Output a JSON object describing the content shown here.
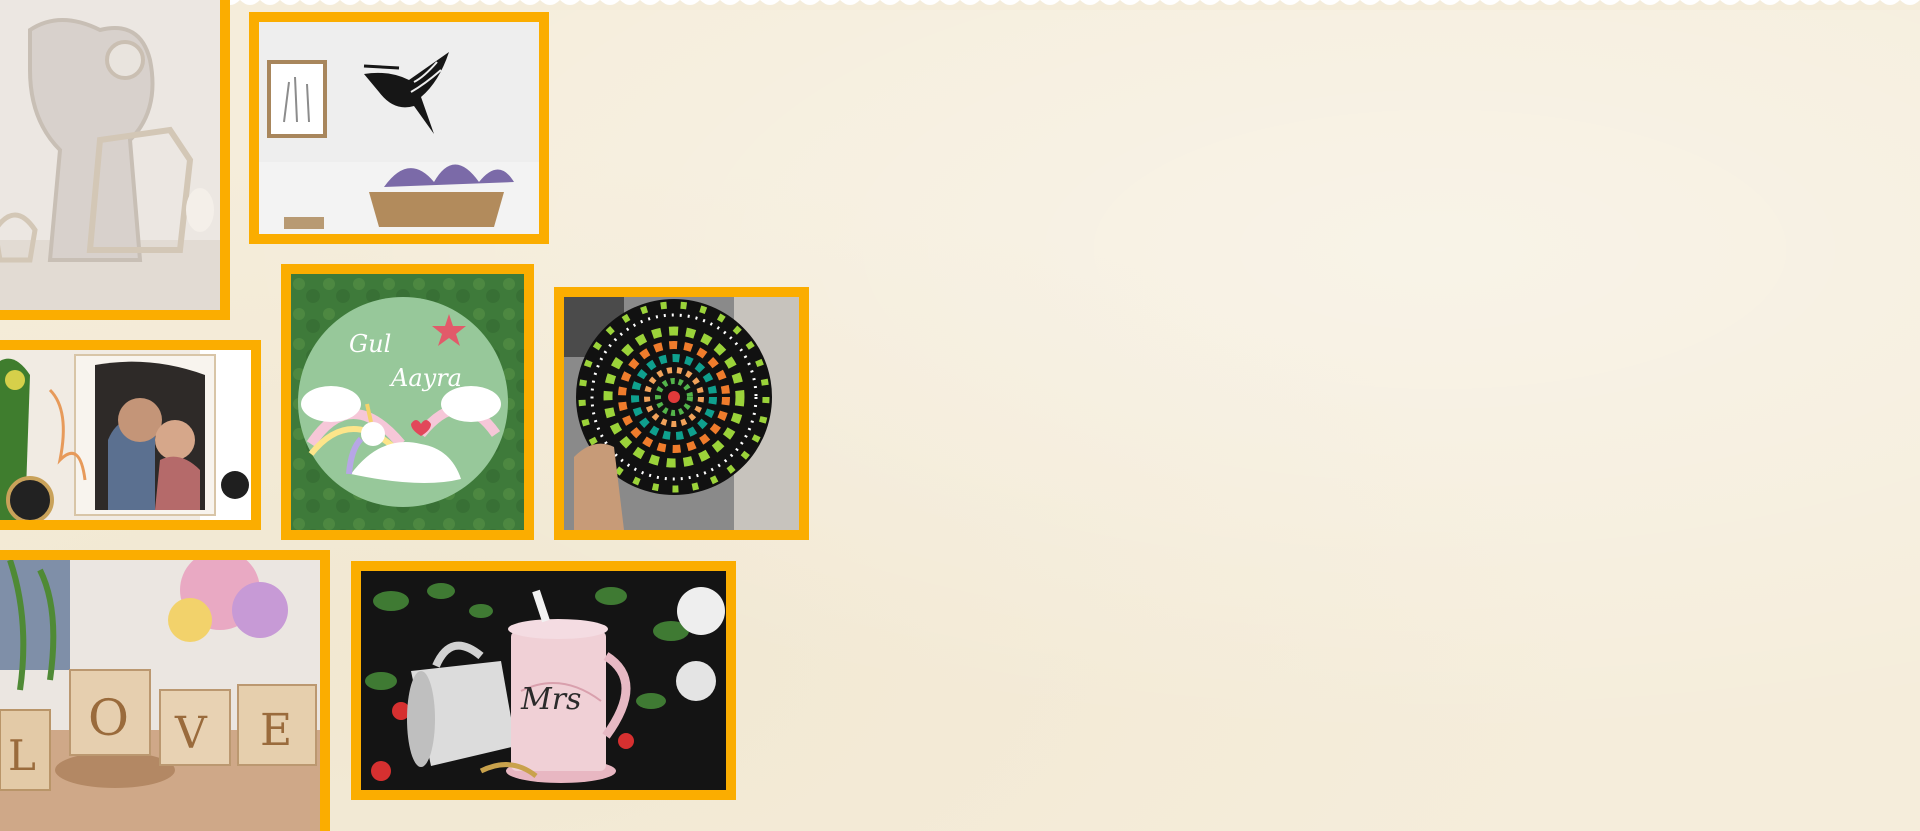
{
  "colors": {
    "frame": "#fbad00",
    "background": "#f5eddb"
  },
  "gallery": [
    {
      "id": "deer-lamp",
      "subject": "wooden-deer-lamp-icon"
    },
    {
      "id": "hummingbird",
      "subject": "hummingbird-wall-art-icon"
    },
    {
      "id": "name-plate",
      "subject": "unicorn-name-plate-icon",
      "text_line1": "Gul",
      "text_line2": "Aayra"
    },
    {
      "id": "mandala",
      "subject": "dot-mandala-icon"
    },
    {
      "id": "photo-frame",
      "subject": "couple-photo-frame-icon"
    },
    {
      "id": "love-blocks",
      "subject": "love-candle-blocks-icon",
      "letters": [
        "L",
        "O",
        "V",
        "E"
      ]
    },
    {
      "id": "mugs",
      "subject": "marble-mugs-icon",
      "mug_text": "Mrs"
    }
  ]
}
